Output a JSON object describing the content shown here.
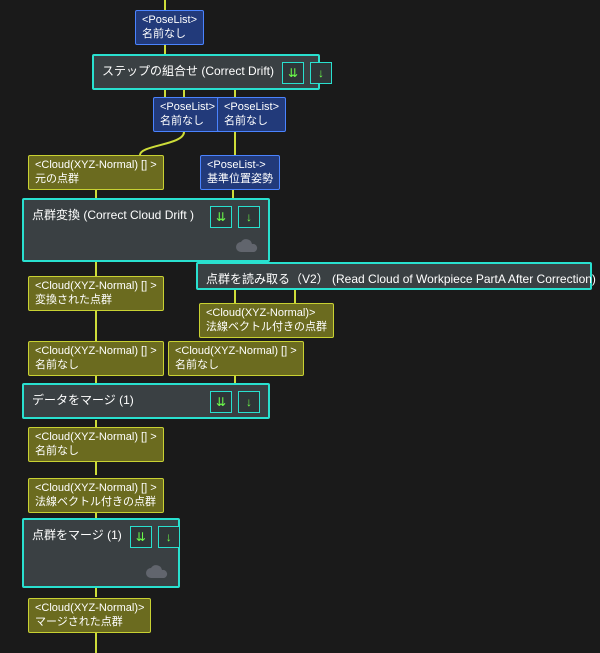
{
  "colors": {
    "canvas_bg": "#1a1a1a",
    "teal": "#29e0cf",
    "olive_fill": "#6b6b1f",
    "olive_border": "#c8d132",
    "navy_fill": "#223a7a",
    "navy_border": "#4a83ff",
    "wire": "#cddc39"
  },
  "icons": {
    "expand": "⇊",
    "down": "↓"
  },
  "types": {
    "poselist": "<PoseList>",
    "poselist_arrow": "<PoseList->",
    "cloud_arr": "<Cloud(XYZ-Normal) [] >",
    "cloud": "<Cloud(XYZ-Normal)>"
  },
  "labels": {
    "noname": "名前なし",
    "ref_pose": "基準位置姿勢",
    "orig_cloud": "元の点群",
    "transformed_cloud": "変換された点群",
    "normal_cloud": "法線ベクトル付きの点群",
    "merged_cloud": "マージされた点群"
  },
  "nodes": {
    "n1": {
      "title": "ステップの組合せ (Correct Drift)"
    },
    "n2": {
      "title": "点群変換 (Correct Cloud Drift )"
    },
    "n3": {
      "title": "点群を読み取る（V2）  (Read Cloud of  Workpiece PartA After Correction)"
    },
    "n4": {
      "title": "データをマージ (1)"
    },
    "n5": {
      "title": "点群をマージ (1)"
    }
  }
}
